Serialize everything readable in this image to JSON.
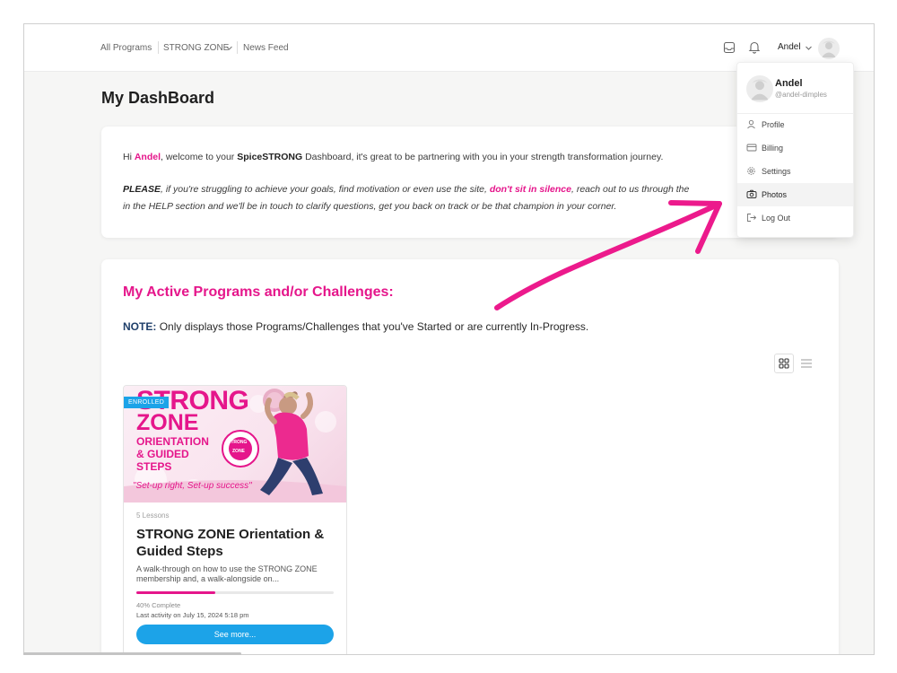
{
  "nav": {
    "all_programs": "All Programs",
    "strong_zone": "STRONG ZONE",
    "news_feed": "News Feed"
  },
  "user": {
    "name": "Andel",
    "handle": "@andel-dimples"
  },
  "page_title": "My DashBoard",
  "welcome": {
    "hi": "Hi",
    "name": "Andel",
    "mid": ", welcome to your",
    "brand": "SpiceSTRONG",
    "rest": "Dashboard, it's great to be partnering with you in your strength transformation journey.",
    "please": "PLEASE",
    "p1": ", if you're struggling to achieve your goals, find motivation or even use the site,",
    "dont": "don't sit in silence",
    "p2": ", reach out to us through the",
    "line3": "in the HELP section and we'll be in touch to clarify questions, get you back on track or be that champion in your corner."
  },
  "programs": {
    "title": "My Active Programs and/or Challenges:",
    "note_label": "NOTE:",
    "note_text": "Only displays those Programs/Challenges that you've Started or are currently In-Progress."
  },
  "course": {
    "badge": "ENROLLED",
    "image_text": {
      "line1": "STRONG",
      "line2": "ZONE",
      "line3": "ORIENTATION",
      "line4": "& GUIDED",
      "line5": "STEPS",
      "tagline": "\"Set-up right, Set-up success\"",
      "seal_line1": "STRONG",
      "seal_line2": "ZONE"
    },
    "lessons": "5 Lessons",
    "title": "STRONG ZONE Orientation & Guided Steps",
    "description": "A walk-through on how to use the STRONG ZONE membership and, a walk-alongside on...",
    "progress_percent": 40,
    "progress_text": "40% Complete",
    "last_activity": "Last activity on July 15, 2024 5:18 pm",
    "button": "See more..."
  },
  "dropdown": {
    "items": [
      {
        "label": "Profile",
        "icon": "user-icon"
      },
      {
        "label": "Billing",
        "icon": "credit-card-icon"
      },
      {
        "label": "Settings",
        "icon": "gear-icon"
      },
      {
        "label": "Photos",
        "icon": "camera-icon"
      },
      {
        "label": "Log Out",
        "icon": "logout-icon"
      }
    ]
  },
  "colors": {
    "brand_pink": "#e5168b",
    "button_blue": "#1ca3e8",
    "page_bg": "#f6f6f5"
  }
}
